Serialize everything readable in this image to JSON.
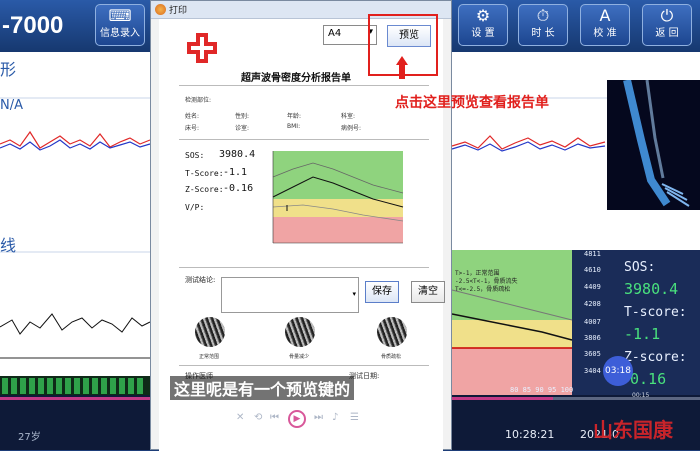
{
  "app": {
    "title": "-7000"
  },
  "toolbar": {
    "entry_label": "信息录入",
    "settings_label": "设 置",
    "duration_label": "时 长",
    "calibrate_label": "校 准",
    "back_label": "返 回"
  },
  "background": {
    "wave_label": "形",
    "sub_label": "N/A",
    "trend_label": "线",
    "age_text": "27岁",
    "time_text": "10:28:21",
    "date_text": "2021-0",
    "watermark": "山东国康"
  },
  "results": {
    "sos_label": "SOS:",
    "sos_value": "3980.4",
    "tscore_label": "T-score:",
    "tscore_value": "-1.1",
    "zscore_label": "Z-score:",
    "zscore_value": "0.16",
    "legend_normal": "T>-1，正常范围",
    "legend_loss": "-2.5<T<-1，骨质流失",
    "legend_osteo": "T<=-2.5，骨质疏松",
    "y_ticks": [
      "4811",
      "4610",
      "4409",
      "4208",
      "4007",
      "3806",
      "3605",
      "3404"
    ],
    "x_ticks": "80  85  90  95  100",
    "timer_badge": "03:18"
  },
  "dialog": {
    "title": "打印",
    "paper_size": "A4",
    "preview_label": "预览",
    "report_title": "超声波骨密度分析报告单",
    "dept_label": "检测部位:",
    "name_label": "姓名:",
    "gender_label": "性别:",
    "age_label": "年龄:",
    "section_label": "科室:",
    "bed_label": "床号:",
    "phone_label": "诊室:",
    "bmi_label": "BMI:",
    "case_label": "病例号:",
    "sos_label": "SOS:",
    "sos_value": "3980.4",
    "tscore_label": "T-Score:",
    "tscore_value": "-1.1",
    "zscore_label": "Z-Score:",
    "zscore_value": "-0.16",
    "vp_label": "V/P:",
    "conclusion_label": "测试结论:",
    "save_label": "保存",
    "clear_label": "清空",
    "xray1_label": "正常范围",
    "xray2_label": "骨量减少",
    "xray3_label": "骨质疏松",
    "doctor_label": "操作医师",
    "test_date_label": "测试日期:"
  },
  "annotation": {
    "text": "点击这里预览查看报告单",
    "color": "#e1201d"
  },
  "subtitle": {
    "text": "这里呢是有一个预览键的"
  },
  "video": {
    "progress_percent": 79,
    "elapsed": "00:15"
  },
  "colors": {
    "normal_zone": "#8fd37e",
    "loss_zone": "#f0e08a",
    "osteo_zone": "#f0a4a4",
    "accent": "#e1201d"
  }
}
